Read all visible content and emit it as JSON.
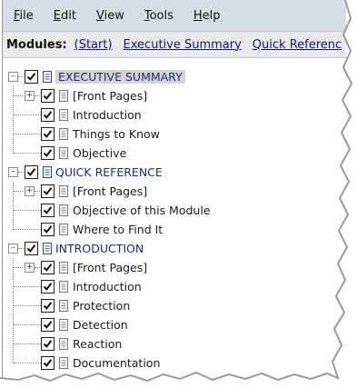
{
  "menu": {
    "items": [
      {
        "label": "File",
        "u": "F",
        "rest": "ile"
      },
      {
        "label": "Edit",
        "u": "E",
        "rest": "dit"
      },
      {
        "label": "View",
        "u": "V",
        "rest": "iew"
      },
      {
        "label": "Tools",
        "u": "T",
        "rest": "ools"
      },
      {
        "label": "Help",
        "u": "H",
        "rest": "elp"
      }
    ]
  },
  "modules": {
    "label": "Modules:",
    "links": [
      "(Start)",
      "Executive Summary",
      "Quick Referenc"
    ]
  },
  "tree": {
    "sections": [
      {
        "label": "EXECUTIVE SUMMARY",
        "selected": true,
        "children": [
          {
            "label": "[Front Pages]",
            "expandable": true
          },
          {
            "label": "Introduction"
          },
          {
            "label": "Things to Know"
          },
          {
            "label": "Objective"
          }
        ]
      },
      {
        "label": "QUICK REFERENCE",
        "children": [
          {
            "label": "[Front Pages]",
            "expandable": true
          },
          {
            "label": "Objective of this Module"
          },
          {
            "label": "Where to Find It"
          }
        ]
      },
      {
        "label": "INTRODUCTION",
        "children": [
          {
            "label": "[Front Pages]",
            "expandable": true
          },
          {
            "label": "Introduction"
          },
          {
            "label": "Protection"
          },
          {
            "label": "Detection"
          },
          {
            "label": "Reaction"
          },
          {
            "label": "Documentation"
          }
        ]
      }
    ]
  },
  "colors": {
    "menubar_bg": "#d7dde7",
    "section_text": "#1c2b7a",
    "link": "#0a1a7a",
    "selection_bg": "#d4d4d4"
  }
}
